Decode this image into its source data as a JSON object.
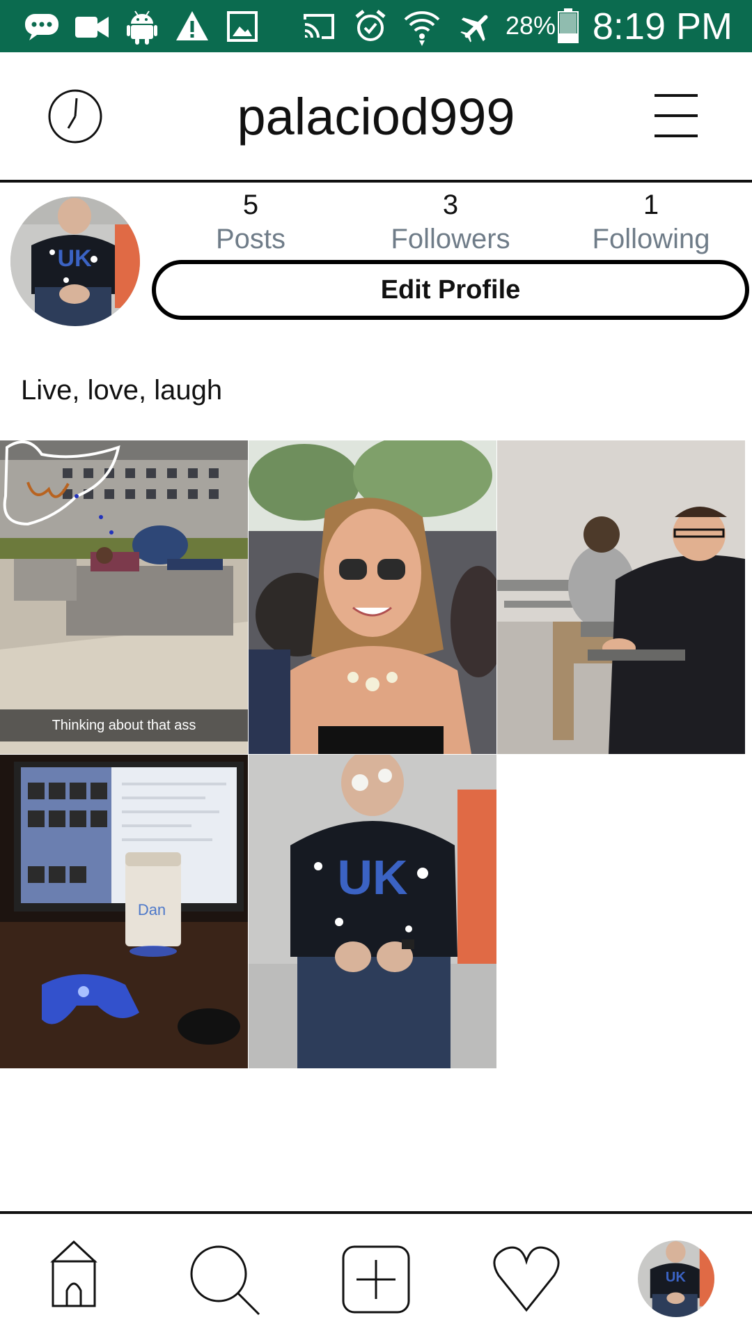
{
  "status_bar": {
    "battery_percent": "28%",
    "time": "8:19 PM",
    "icons": [
      "message-icon",
      "video-icon",
      "android-icon",
      "warning-icon",
      "image-icon",
      "cast-icon",
      "alarm-icon",
      "wifi-icon",
      "airplane-icon",
      "battery-icon"
    ],
    "background_color": "#0b6b4f"
  },
  "header": {
    "username": "palaciod999",
    "left_icon": "clock-icon",
    "right_icon": "menu-icon"
  },
  "profile": {
    "avatar_icon": "profile-avatar",
    "stats": [
      {
        "count": "5",
        "label": "Posts"
      },
      {
        "count": "3",
        "label": "Followers"
      },
      {
        "count": "1",
        "label": "Following"
      }
    ],
    "edit_button_label": "Edit Profile",
    "bio": "Live, love, laugh"
  },
  "posts": [
    {
      "thumbnail": "photo-person-lying-on-stone-bench",
      "caption": "Thinking about that ass"
    },
    {
      "thumbnail": "photo-woman-with-sunglasses-selfie",
      "caption": ""
    },
    {
      "thumbnail": "photo-two-men-in-classroom",
      "caption": ""
    },
    {
      "thumbnail": "photo-computer-desk-with-cup-and-controller",
      "caption": "Dan"
    },
    {
      "thumbnail": "photo-man-in-uk-hoodie-covered-in-cream",
      "caption": ""
    }
  ],
  "bottom_nav": {
    "items": [
      "home-icon",
      "search-icon",
      "add-post-icon",
      "heart-icon",
      "profile-avatar-icon"
    ]
  }
}
